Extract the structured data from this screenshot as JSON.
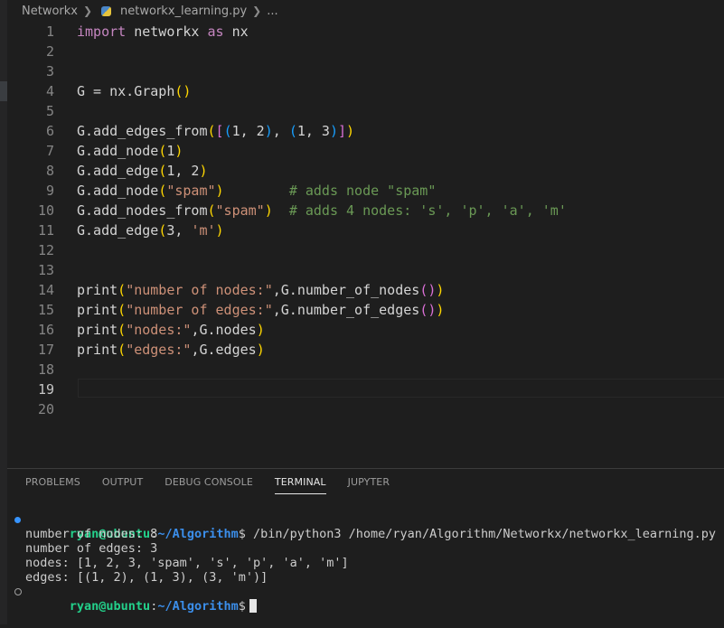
{
  "breadcrumb": {
    "folder": "Networkx",
    "file": "networkx_learning.py",
    "more": "..."
  },
  "editor": {
    "active_line": 19,
    "lines": [
      {
        "n": "1",
        "tokens": [
          {
            "t": "import",
            "c": "kwp"
          },
          {
            "t": " networkx ",
            "c": "plain"
          },
          {
            "t": "as",
            "c": "kwp"
          },
          {
            "t": " nx",
            "c": "plain"
          }
        ]
      },
      {
        "n": "2",
        "tokens": []
      },
      {
        "n": "3",
        "tokens": []
      },
      {
        "n": "4",
        "tokens": [
          {
            "t": "G = nx.",
            "c": "plain"
          },
          {
            "t": "Graph",
            "c": "plain"
          },
          {
            "t": "()",
            "c": "b1"
          }
        ]
      },
      {
        "n": "5",
        "tokens": []
      },
      {
        "n": "6",
        "tokens": [
          {
            "t": "G.add_edges_from",
            "c": "plain"
          },
          {
            "t": "(",
            "c": "b1"
          },
          {
            "t": "[",
            "c": "b2"
          },
          {
            "t": "(",
            "c": "b3"
          },
          {
            "t": "1, 2",
            "c": "plain"
          },
          {
            "t": ")",
            "c": "b3"
          },
          {
            "t": ", ",
            "c": "plain"
          },
          {
            "t": "(",
            "c": "b3"
          },
          {
            "t": "1, 3",
            "c": "plain"
          },
          {
            "t": ")",
            "c": "b3"
          },
          {
            "t": "]",
            "c": "b2"
          },
          {
            "t": ")",
            "c": "b1"
          }
        ]
      },
      {
        "n": "7",
        "tokens": [
          {
            "t": "G.add_node",
            "c": "plain"
          },
          {
            "t": "(",
            "c": "b1"
          },
          {
            "t": "1",
            "c": "plain"
          },
          {
            "t": ")",
            "c": "b1"
          }
        ]
      },
      {
        "n": "8",
        "tokens": [
          {
            "t": "G.add_edge",
            "c": "plain"
          },
          {
            "t": "(",
            "c": "b1"
          },
          {
            "t": "1, 2",
            "c": "plain"
          },
          {
            "t": ")",
            "c": "b1"
          }
        ]
      },
      {
        "n": "9",
        "tokens": [
          {
            "t": "G.add_node",
            "c": "plain"
          },
          {
            "t": "(",
            "c": "b1"
          },
          {
            "t": "\"spam\"",
            "c": "str"
          },
          {
            "t": ")",
            "c": "b1"
          },
          {
            "t": "        ",
            "c": "plain"
          },
          {
            "t": "# adds node \"spam\"",
            "c": "cmt"
          }
        ]
      },
      {
        "n": "10",
        "tokens": [
          {
            "t": "G.add_nodes_from",
            "c": "plain"
          },
          {
            "t": "(",
            "c": "b1"
          },
          {
            "t": "\"spam\"",
            "c": "str"
          },
          {
            "t": ")",
            "c": "b1"
          },
          {
            "t": "  ",
            "c": "plain"
          },
          {
            "t": "# adds 4 nodes: 's', 'p', 'a', 'm'",
            "c": "cmt"
          }
        ]
      },
      {
        "n": "11",
        "tokens": [
          {
            "t": "G.add_edge",
            "c": "plain"
          },
          {
            "t": "(",
            "c": "b1"
          },
          {
            "t": "3, ",
            "c": "plain"
          },
          {
            "t": "'m'",
            "c": "str"
          },
          {
            "t": ")",
            "c": "b1"
          }
        ]
      },
      {
        "n": "12",
        "tokens": []
      },
      {
        "n": "13",
        "tokens": []
      },
      {
        "n": "14",
        "tokens": [
          {
            "t": "print",
            "c": "plain"
          },
          {
            "t": "(",
            "c": "b1"
          },
          {
            "t": "\"number of nodes:\"",
            "c": "str"
          },
          {
            "t": ",G.number_of_nodes",
            "c": "plain"
          },
          {
            "t": "()",
            "c": "b2"
          },
          {
            "t": ")",
            "c": "b1"
          }
        ]
      },
      {
        "n": "15",
        "tokens": [
          {
            "t": "print",
            "c": "plain"
          },
          {
            "t": "(",
            "c": "b1"
          },
          {
            "t": "\"number of edges:\"",
            "c": "str"
          },
          {
            "t": ",G.number_of_edges",
            "c": "plain"
          },
          {
            "t": "()",
            "c": "b2"
          },
          {
            "t": ")",
            "c": "b1"
          }
        ]
      },
      {
        "n": "16",
        "tokens": [
          {
            "t": "print",
            "c": "plain"
          },
          {
            "t": "(",
            "c": "b1"
          },
          {
            "t": "\"nodes:\"",
            "c": "str"
          },
          {
            "t": ",G.nodes",
            "c": "plain"
          },
          {
            "t": ")",
            "c": "b1"
          }
        ]
      },
      {
        "n": "17",
        "tokens": [
          {
            "t": "print",
            "c": "plain"
          },
          {
            "t": "(",
            "c": "b1"
          },
          {
            "t": "\"edges:\"",
            "c": "str"
          },
          {
            "t": ",G.edges",
            "c": "plain"
          },
          {
            "t": ")",
            "c": "b1"
          }
        ]
      },
      {
        "n": "18",
        "tokens": []
      },
      {
        "n": "19",
        "tokens": []
      },
      {
        "n": "20",
        "tokens": []
      }
    ]
  },
  "panel": {
    "tabs": [
      "PROBLEMS",
      "OUTPUT",
      "DEBUG CONSOLE",
      "TERMINAL",
      "JUPYTER"
    ],
    "active_tab": "TERMINAL"
  },
  "terminal": {
    "user": "ryan@ubuntu",
    "sep": ":",
    "path": "~/Algorithm",
    "prompt_char": "$",
    "command": " /bin/python3 /home/ryan/Algorithm/Networkx/networkx_learning.py",
    "output": [
      "number of nodes: 8",
      "number of edges: 3",
      "nodes: [1, 2, 3, 'spam', 's', 'p', 'a', 'm']",
      "edges: [(1, 2), (1, 3), (3, 'm')]"
    ]
  }
}
